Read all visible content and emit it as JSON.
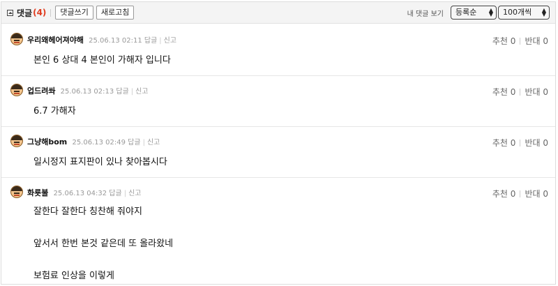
{
  "toolbar": {
    "title": "댓글",
    "count": "(4)",
    "write_label": "댓글쓰기",
    "refresh_label": "새로고침",
    "my_comments_label": "내 댓글 보기",
    "sort_value": "등록순",
    "per_page_value": "100개씩"
  },
  "vote_labels": {
    "up": "추천",
    "down": "반대"
  },
  "comments": [
    {
      "nick": "우리왜헤어져야해",
      "time": "25.06.13 02:11",
      "reply": "답글",
      "report": "신고",
      "up": "0",
      "down": "0",
      "lines": [
        "본인 6 상대 4 본인이 가해자 입니다"
      ]
    },
    {
      "nick": "업드려쏴",
      "time": "25.06.13 02:13",
      "reply": "답글",
      "report": "신고",
      "up": "0",
      "down": "0",
      "lines": [
        "6.7 가해자"
      ]
    },
    {
      "nick": "그냥해bom",
      "time": "25.06.13 02:49",
      "reply": "답글",
      "report": "신고",
      "up": "0",
      "down": "0",
      "lines": [
        "일시정지 표지판이 있나 찾아봅시다"
      ]
    },
    {
      "nick": "화룟불",
      "time": "25.06.13 04:32",
      "reply": "답글",
      "report": "신고",
      "up": "0",
      "down": "0",
      "lines": [
        "잘한다 잘한다 칭찬해 줘야지",
        "",
        "앞서서 한번 본것 같은데 또 올라왔네",
        "",
        "보험료 인상을 이렇게"
      ]
    }
  ]
}
